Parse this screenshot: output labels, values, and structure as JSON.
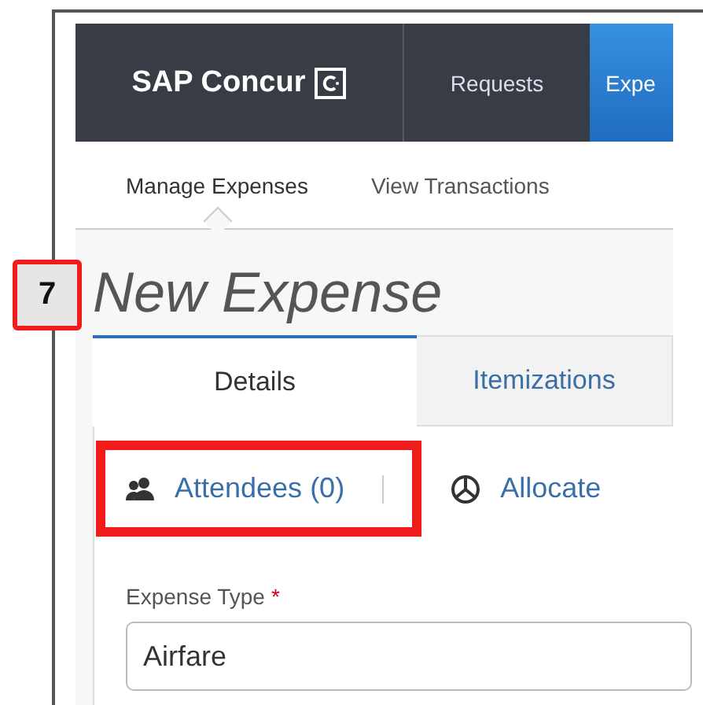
{
  "step_badge": "7",
  "navbar": {
    "logo": "SAP Concur",
    "items": [
      {
        "label": "Requests",
        "selected": false
      },
      {
        "label": "Expe",
        "selected": true
      }
    ]
  },
  "subnav": [
    {
      "label": "Manage Expenses",
      "selected": true
    },
    {
      "label": "View Transactions",
      "selected": false
    }
  ],
  "title": "New Expense",
  "tabs": [
    {
      "label": "Details",
      "selected": true
    },
    {
      "label": "Itemizations",
      "selected": false
    }
  ],
  "actions": [
    {
      "kind": "attendees",
      "label": "Attendees (0)",
      "highlighted": true
    },
    {
      "kind": "allocate",
      "label": "Allocate",
      "highlighted": false
    }
  ],
  "fields": [
    {
      "label": "Expense Type",
      "required": true,
      "required_mark": "*",
      "value": "Airfare"
    }
  ]
}
